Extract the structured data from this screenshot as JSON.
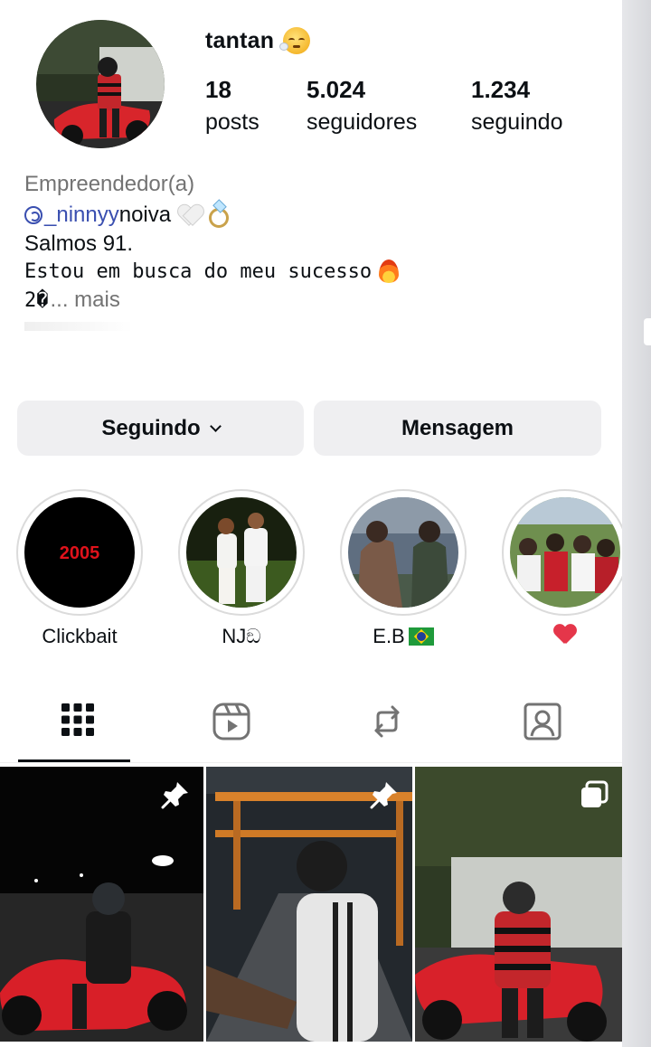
{
  "profile": {
    "username": "tantan",
    "username_emoji_icon": "face-exhaling-emoji",
    "stats": {
      "posts_count": "18",
      "posts_label": "posts",
      "followers_count": "5.024",
      "followers_label": "seguidores",
      "following_count": "1.234",
      "following_label": "seguindo"
    },
    "category": "Empreendedor(a)",
    "bio": {
      "line1_link": "_ninnyy",
      "line1_text": " noiva",
      "line2": "Salmos 91.",
      "line3": "Estou em busca do meu sucesso",
      "line4_text": "2�",
      "more_label": "... mais"
    }
  },
  "actions": {
    "following_button": "Seguindo",
    "message_button": "Mensagem"
  },
  "highlights": [
    {
      "label": "Clickbait",
      "cover_text": "2005"
    },
    {
      "label": "NJඞ"
    },
    {
      "label": "E.B"
    },
    {
      "label": ""
    }
  ],
  "tabs": [
    {
      "name": "posts-grid",
      "icon": "grid-icon",
      "active": true
    },
    {
      "name": "reels",
      "icon": "reels-icon",
      "active": false
    },
    {
      "name": "reposts",
      "icon": "repost-icon",
      "active": false
    },
    {
      "name": "tagged",
      "icon": "tagged-user-icon",
      "active": false
    }
  ],
  "posts": [
    {
      "badge": "pin-icon"
    },
    {
      "badge": "pin-icon"
    },
    {
      "badge": "carousel-icon"
    }
  ],
  "colors": {
    "button_bg": "#efeff1",
    "link": "#3a4fb0",
    "secondary_text": "#737373"
  }
}
